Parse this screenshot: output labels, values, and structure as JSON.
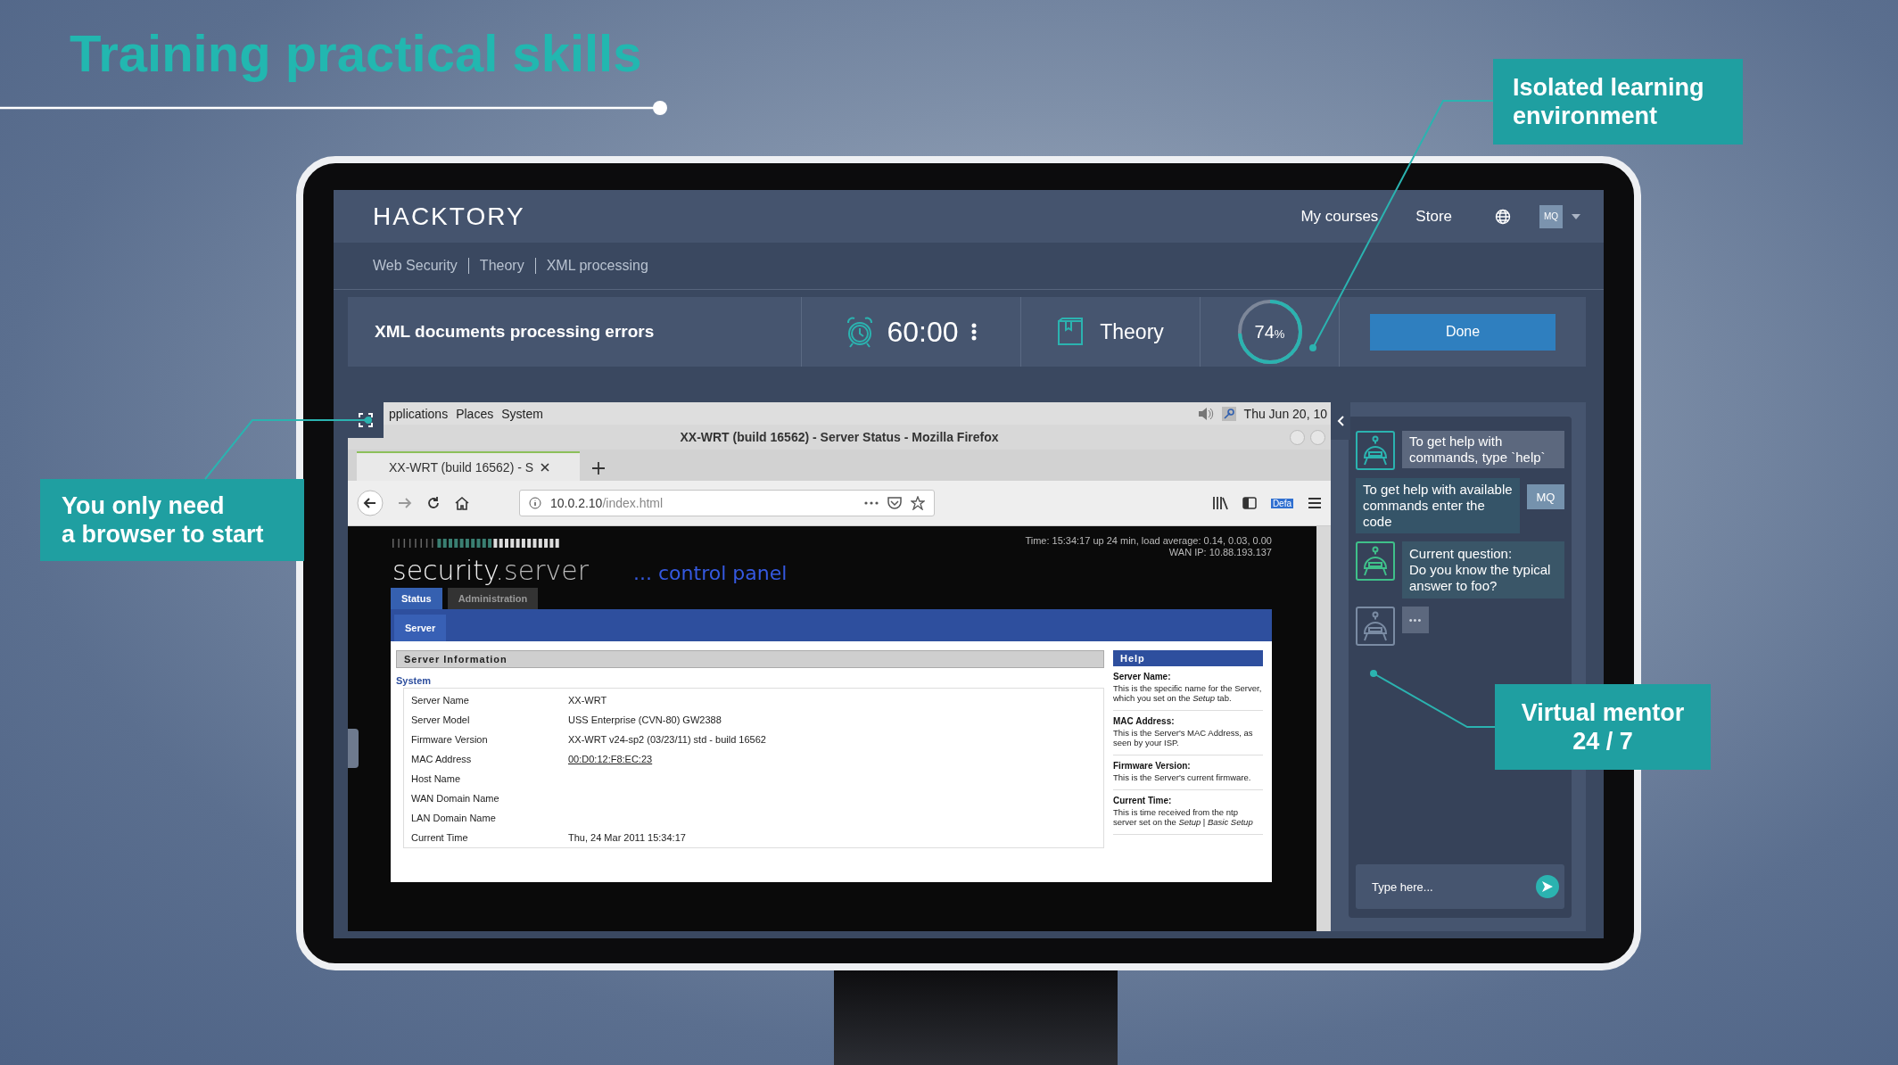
{
  "slide": {
    "title": "Training practical skills",
    "callouts": [
      {
        "kind": "environment",
        "lines": [
          "Isolated learning",
          "environment"
        ]
      },
      {
        "kind": "browser",
        "lines": [
          "You only need",
          "a browser to start"
        ]
      },
      {
        "kind": "mentor",
        "lines": [
          "Virtual mentor",
          "24 / 7"
        ]
      }
    ]
  },
  "app": {
    "logo": "HACKTORY",
    "nav": [
      "My courses",
      "Store"
    ],
    "avatar": "MQ",
    "breadcrumbs": [
      "Web Security",
      "Theory",
      "XML processing"
    ],
    "task": {
      "title": "XML documents processing errors",
      "timer": "60:00",
      "section": "Theory",
      "progress": {
        "level": 0.74,
        "value": "74",
        "unit": "%"
      },
      "done": "Done"
    },
    "desktop": {
      "menus": [
        "pplications",
        "Places",
        "System"
      ],
      "clock": "Thu Jun 20, 10"
    },
    "browser": {
      "window_title": "XX-WRT (build 16562) - Server Status - Mozilla Firefox",
      "tab": "XX-WRT (build 16562) - S",
      "url_host": "10.0.2.10",
      "url_path": "/index.html",
      "badge": "Defa"
    },
    "page": {
      "brand": "security",
      "brand_suffix": ".server",
      "tagline": "... control panel",
      "status": [
        "Time: 15:34:17 up 24 min, load average: 0.14, 0.03, 0.00",
        "WAN IP: 10.88.193.137"
      ],
      "tabs": [
        {
          "label": "Status",
          "selected": true
        },
        {
          "label": "Administration",
          "selected": false
        }
      ],
      "subtab": "Server",
      "section": "Server Information",
      "group": "System",
      "rows": [
        {
          "label": "Server Name",
          "value": "XX-WRT"
        },
        {
          "label": "Server Model",
          "value": "USS Enterprise (CVN-80) GW2388"
        },
        {
          "label": "Firmware Version",
          "value": "XX-WRT v24-sp2 (03/23/11) std - build 16562"
        },
        {
          "label": "MAC Address",
          "value": "00:D0:12:F8:EC:23",
          "kind": "link"
        },
        {
          "label": "Host Name"
        },
        {
          "label": "WAN Domain Name"
        },
        {
          "label": "LAN Domain Name"
        },
        {
          "label": "Current Time",
          "value": "Thu, 24 Mar 2011 15:34:17"
        }
      ],
      "help_title": "Help",
      "help": [
        {
          "title": "Server Name:",
          "text": "This is the specific name for the Server, which you set on the *Setup* tab."
        },
        {
          "title": "MAC Address:",
          "text": "This is the Server's MAC Address, as seen by your ISP."
        },
        {
          "title": "Firmware Version:",
          "text": "This is the Server's current firmware."
        },
        {
          "title": "Current Time:",
          "text": "This is time received from the ntp server set on the *Setup* | *Basic Setup*"
        }
      ]
    },
    "chat": {
      "messages": [
        {
          "kind": "bot",
          "text": "To get help with commands, type `help`"
        },
        {
          "kind": "user",
          "text": "To get help with available commands enter the code",
          "avatar": "MQ"
        },
        {
          "kind": "question",
          "text": "Current question:\nDo you know the typical answer to foo?"
        },
        {
          "kind": "typing",
          "text": "•••"
        }
      ],
      "placeholder": "Type here..."
    }
  }
}
